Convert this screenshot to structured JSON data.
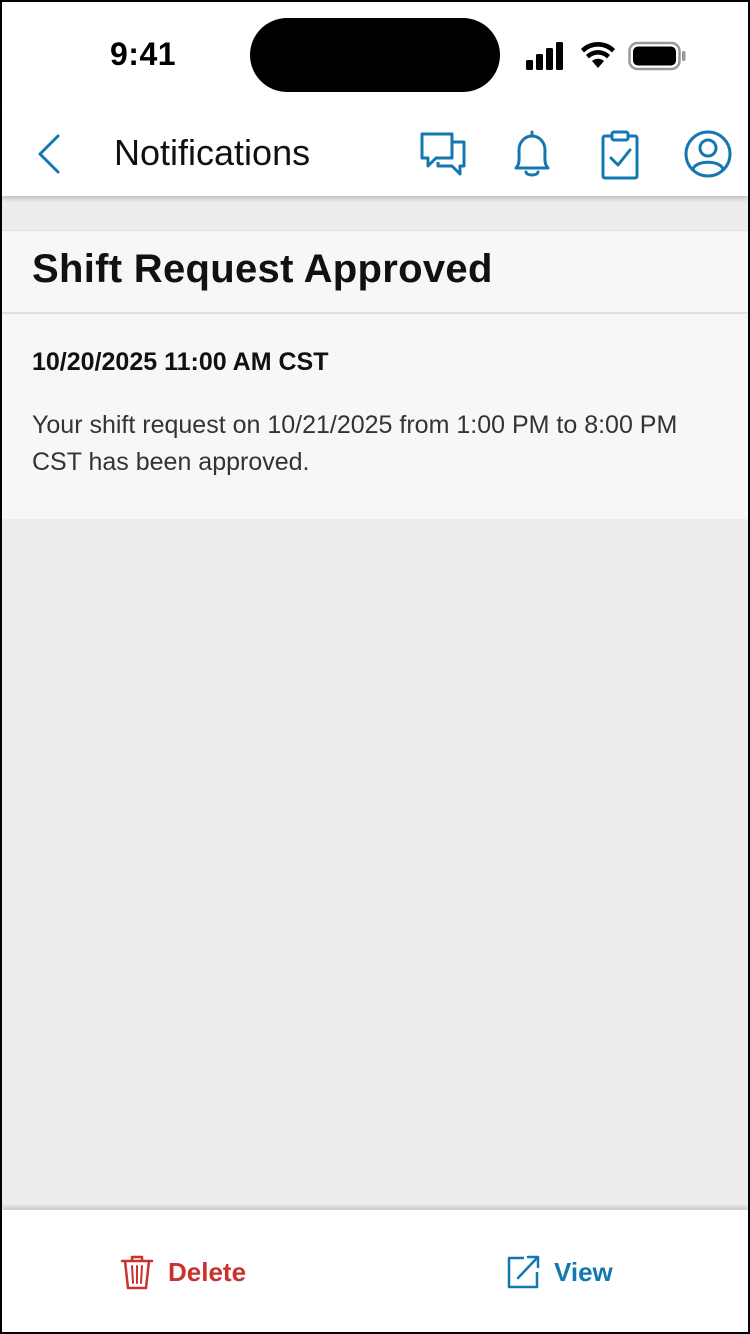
{
  "status_bar": {
    "time": "9:41",
    "icons": [
      "signal-icon",
      "wifi-icon",
      "battery-icon"
    ]
  },
  "header": {
    "title": "Notifications",
    "back_icon": "chevron-left-icon",
    "actions": [
      "chat-icon",
      "bell-icon",
      "clipboard-check-icon",
      "user-icon"
    ]
  },
  "notification": {
    "title": "Shift Request Approved",
    "datetime": "10/20/2025 11:00 AM CST",
    "message": "Your shift request on 10/21/2025 from 1:00 PM to 8:00 PM CST has been approved."
  },
  "bottom_bar": {
    "delete_label": "Delete",
    "view_label": "View"
  },
  "colors": {
    "accent": "#1478b0",
    "danger": "#c8322f",
    "background": "#ededed",
    "card": "#f7f7f7"
  }
}
